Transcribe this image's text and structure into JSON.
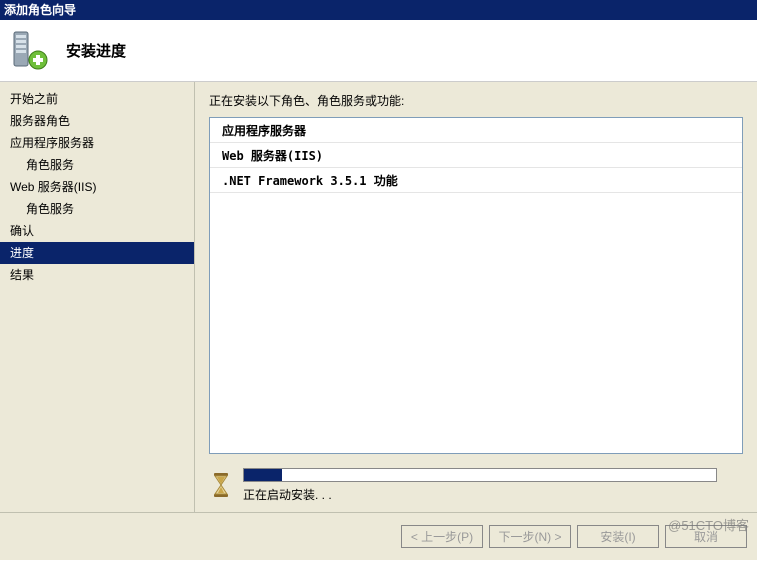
{
  "window": {
    "title": "添加角色向导"
  },
  "header": {
    "page_title": "安装进度"
  },
  "sidebar": {
    "items": [
      {
        "label": "开始之前",
        "indent": false,
        "active": false
      },
      {
        "label": "服务器角色",
        "indent": false,
        "active": false
      },
      {
        "label": "应用程序服务器",
        "indent": false,
        "active": false
      },
      {
        "label": "角色服务",
        "indent": true,
        "active": false
      },
      {
        "label": "Web 服务器(IIS)",
        "indent": false,
        "active": false
      },
      {
        "label": "角色服务",
        "indent": true,
        "active": false
      },
      {
        "label": "确认",
        "indent": false,
        "active": false
      },
      {
        "label": "进度",
        "indent": false,
        "active": true
      },
      {
        "label": "结果",
        "indent": false,
        "active": false
      }
    ]
  },
  "main": {
    "instruction": "正在安装以下角色、角色服务或功能:",
    "groups": [
      {
        "label": "应用程序服务器"
      },
      {
        "label": "Web 服务器(IIS)"
      },
      {
        "label": ".NET Framework 3.5.1 功能"
      }
    ],
    "progress": {
      "percent": 8,
      "status_text": "正在启动安装. . ."
    }
  },
  "buttons": {
    "prev": "< 上一步(P)",
    "next": "下一步(N) >",
    "install": "安装(I)",
    "cancel": "取消"
  },
  "watermark": "@51CTO博客"
}
